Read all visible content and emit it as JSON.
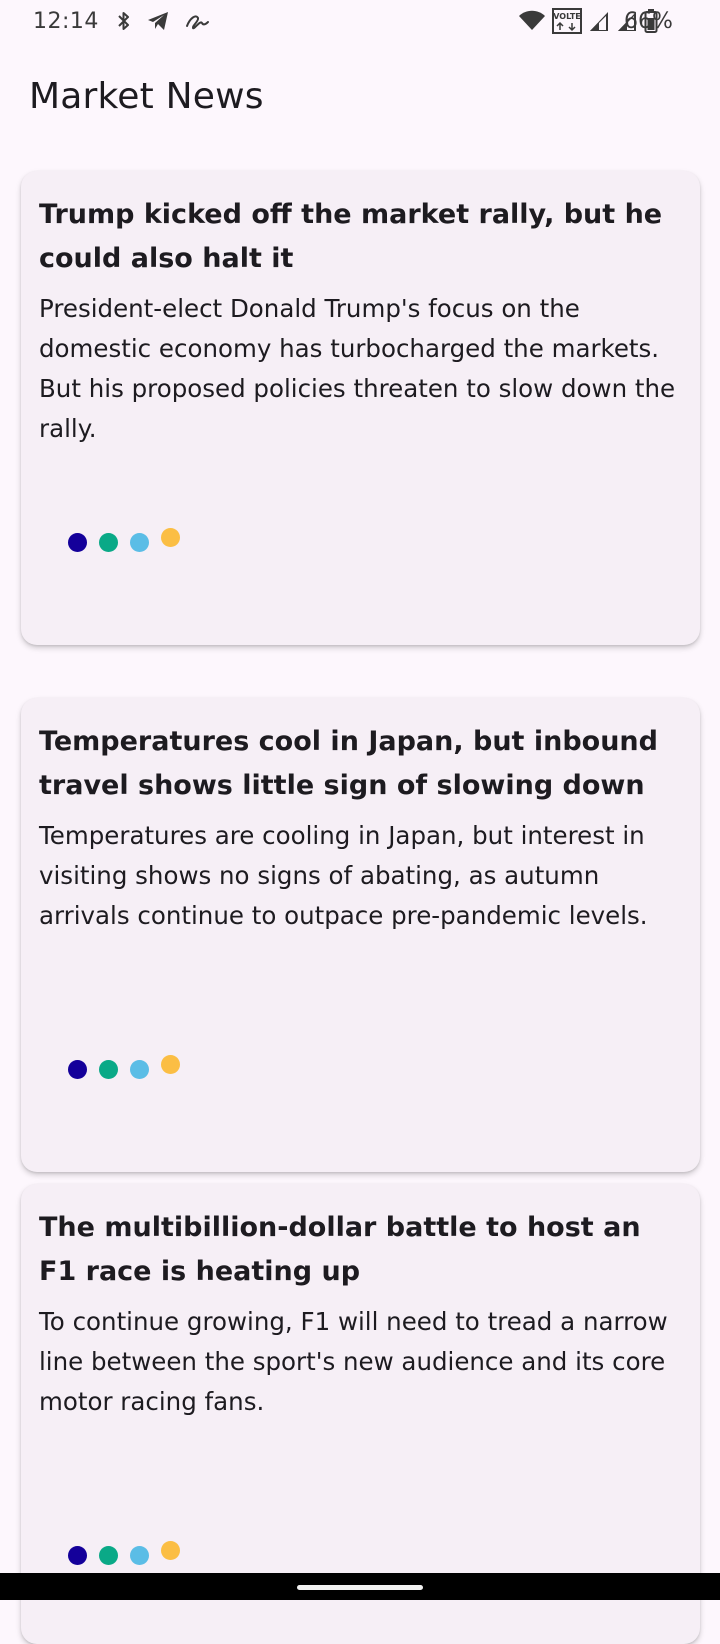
{
  "status_bar": {
    "time": "12:14",
    "battery_percent": "66%",
    "left_icons": [
      "bluetooth-icon",
      "telegram-icon",
      "signature-app-icon"
    ],
    "right_icons": [
      "wifi-icon",
      "volte-icon",
      "signal-icon",
      "signal-icon",
      "battery-icon"
    ],
    "volte_label": "VOLTE"
  },
  "header": {
    "title": "Market News"
  },
  "articles": [
    {
      "title": "Trump kicked off the market rally, but he could also halt it",
      "summary": "President-elect Donald Trump's focus on the domestic economy has turbocharged the markets. But his proposed policies threaten to slow down the rally."
    },
    {
      "title": "Temperatures cool in Japan, but inbound travel shows little sign of slowing down",
      "summary": "Temperatures are cooling in Japan, but interest in visiting shows no signs of abating, as autumn arrivals continue to outpace pre-pandemic levels."
    },
    {
      "title": "The multibillion-dollar battle to host an F1 race is heating up",
      "summary": "To continue growing, F1 will need to tread a narrow line between the sport's new audience and its core motor racing fans."
    }
  ],
  "loading_dot_colors": [
    "#14009a",
    "#0aa987",
    "#5bbde6",
    "#fbbe44"
  ],
  "colors": {
    "background": "#fdf7fd",
    "card": "#f6eff6",
    "text": "#1d1b20"
  }
}
